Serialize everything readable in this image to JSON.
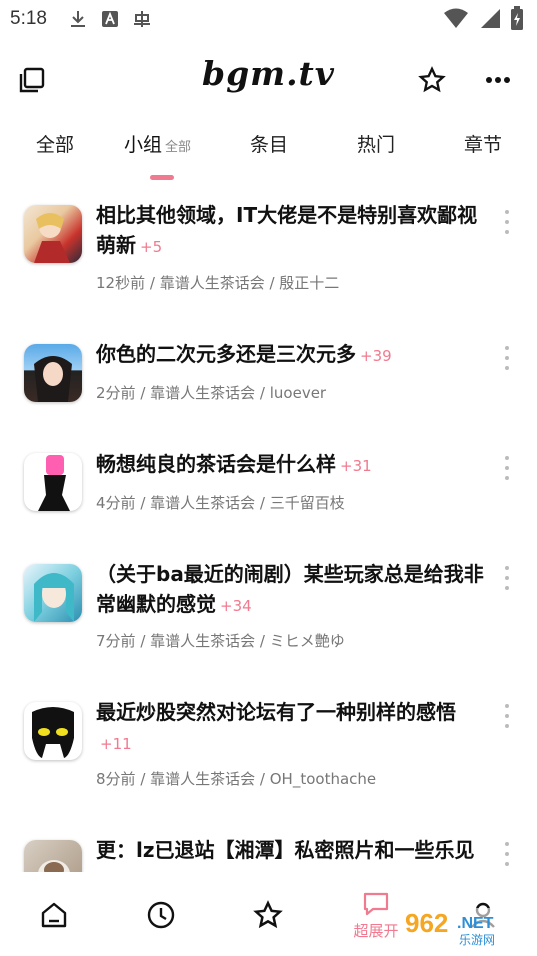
{
  "status_bar": {
    "time": "5:18"
  },
  "app": {
    "logo": "bgm.tv"
  },
  "tabs": [
    {
      "label": "全部"
    },
    {
      "label": "小组",
      "sub": "全部"
    },
    {
      "label": "条目"
    },
    {
      "label": "热门"
    },
    {
      "label": "章节"
    }
  ],
  "topics": [
    {
      "title": "相比其他领域，IT大佬是不是特别喜欢鄙视萌新",
      "count": "+5",
      "time": "12秒前",
      "group": "靠谱人生茶话会",
      "author": "殷正十二"
    },
    {
      "title": "你色的二次元多还是三次元多",
      "count": "+39",
      "time": "2分前",
      "group": "靠谱人生茶话会",
      "author": "luoever"
    },
    {
      "title": "畅想纯良的茶话会是什么样",
      "count": "+31",
      "time": "4分前",
      "group": "靠谱人生茶话会",
      "author": "三千留百枝"
    },
    {
      "title": "（关于ba最近的闹剧）某些玩家总是给我非常幽默的感觉",
      "count": "+34",
      "time": "7分前",
      "group": "靠谱人生茶话会",
      "author": "ミヒメ艶ゆ"
    },
    {
      "title": "最近炒股突然对论坛有了一种别样的感悟",
      "count": "+11",
      "time": "8分前",
      "group": "靠谱人生茶话会",
      "author": "OH_toothache"
    },
    {
      "title": "更：lz已退站【湘潭】私密照片和一些乐见",
      "count": "",
      "time": "",
      "group": "",
      "author": ""
    }
  ],
  "meta_separator": " / ",
  "bottom_nav": {
    "active_label": "超展开"
  },
  "watermark": {
    "text": "962.NET",
    "sub": "乐游网"
  },
  "colors": {
    "accent": "#f07a8f",
    "text": "#111111",
    "meta": "#777777"
  }
}
